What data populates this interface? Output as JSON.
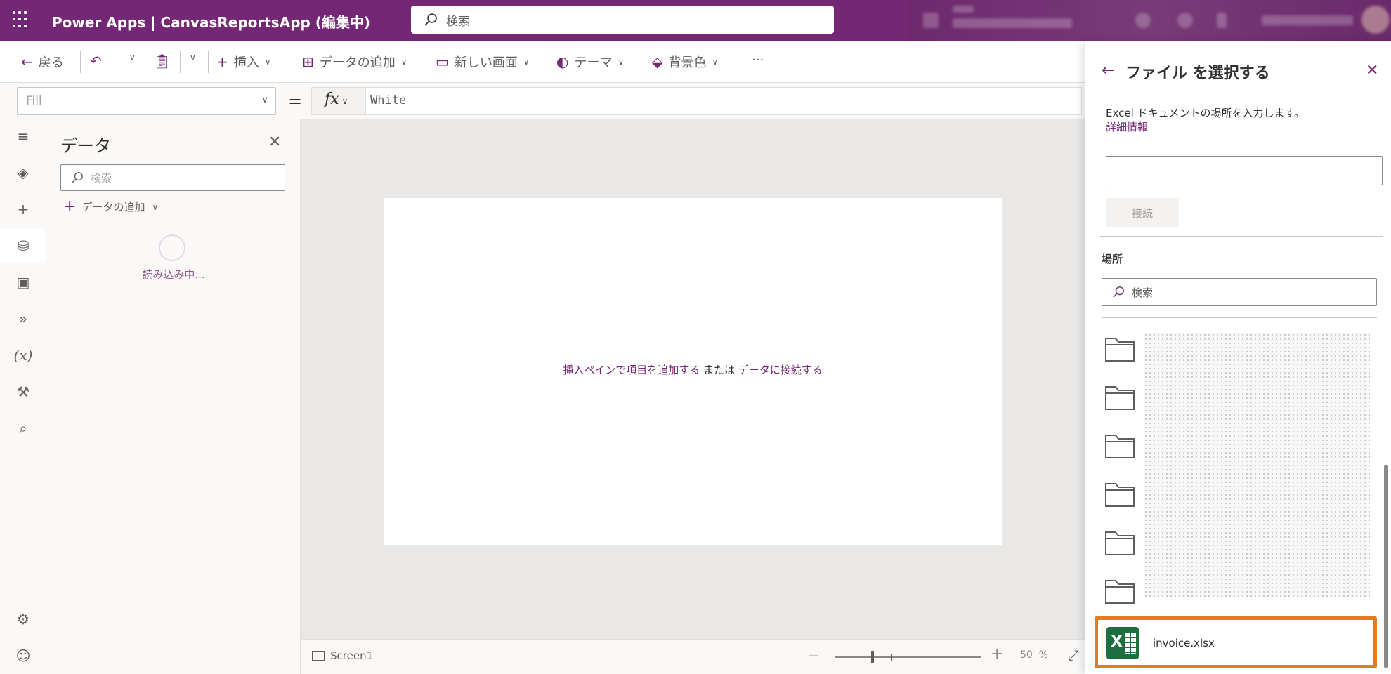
{
  "header": {
    "app_title": "Power Apps | CanvasReportsApp (編集中)",
    "search_placeholder": "検索"
  },
  "command_bar": {
    "back": "戻る",
    "insert": "挿入",
    "add_data": "データの追加",
    "new_screen": "新しい画面",
    "theme": "テーマ",
    "background": "背景色",
    "more": "···"
  },
  "formula_bar": {
    "property": "Fill",
    "equals": "=",
    "fx": "fx",
    "formula": "White"
  },
  "data_panel": {
    "title": "データ",
    "search_placeholder": "検索",
    "add_data": "データの追加",
    "loading": "読み込み中..."
  },
  "canvas": {
    "hint_link1": "挿入ペインで項目を追加する",
    "hint_or": " または ",
    "hint_link2": "データに接続する"
  },
  "status_bar": {
    "screen_name": "Screen1",
    "zoom_value": "50",
    "zoom_unit": "%"
  },
  "file_picker": {
    "title": "ファイル を選択する",
    "description": "Excel ドキュメントの場所を入力します。",
    "learn_more": "詳細情報",
    "connect_button": "接続",
    "location_label": "場所",
    "search_placeholder": "検索",
    "selected_file": "invoice.xlsx"
  },
  "colors": {
    "brand": "#742774",
    "highlight": "#e07b22",
    "excel": "#1d6f42"
  }
}
